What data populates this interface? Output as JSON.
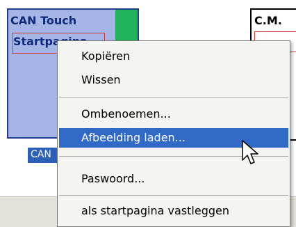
{
  "canvas": {
    "can_tile": {
      "title": "CAN Touch",
      "start_text": "Startpagina"
    },
    "cm_tile": {
      "title": "C.M."
    },
    "can_caption": "CAN"
  },
  "context_menu": {
    "items": [
      {
        "label": "Kopiëren",
        "selected": false
      },
      {
        "label": "Wissen",
        "selected": false
      },
      {
        "label": "Ombenoemen...",
        "selected": false
      },
      {
        "label": "Afbeelding laden...",
        "selected": true
      },
      {
        "label": "Paswoord...",
        "selected": false
      },
      {
        "label": "als startpagina vastleggen",
        "selected": false
      }
    ]
  },
  "colors": {
    "selection": "#3169c6",
    "tile_fill": "#a5b6e6",
    "tile_border": "#1f3f8a",
    "tile_accent": "#20b35a",
    "red_frame": "#d23a3a"
  },
  "cursor": {
    "icon": "arrow-cursor-icon"
  }
}
